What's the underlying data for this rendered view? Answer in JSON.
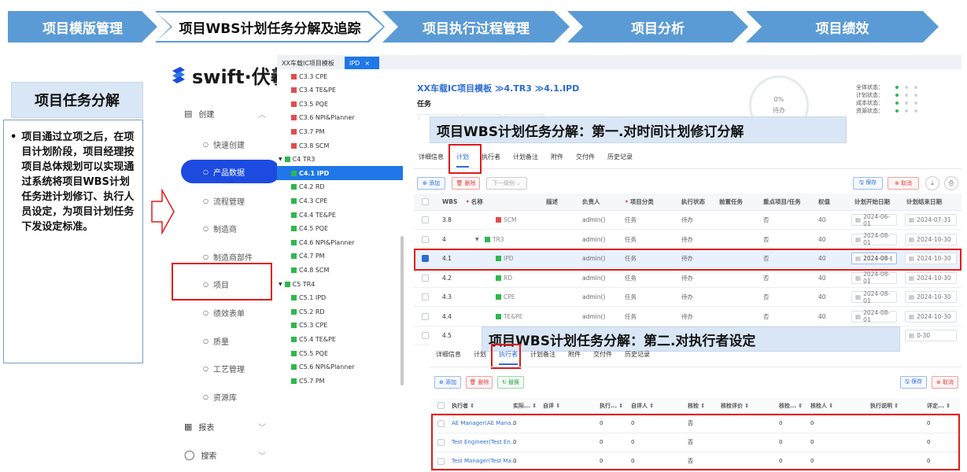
{
  "process": {
    "steps": [
      "项目模版管理",
      "项目WBS计划任务分解及追踪",
      "项目执行过程管理",
      "项目分析",
      "项目绩效"
    ],
    "active_index": 1,
    "colors": {
      "step": "#5b9bd5",
      "active": "#ffffff"
    }
  },
  "left_panel": {
    "title": "项目任务分解",
    "bullet": "•",
    "description": "项目通过立项之后，在项目计划阶段，项目经理按项目总体规划可以实现通过系统将项目WBS计划任务进计划修订、执行人员设定，为项目计划任务下发设定标准。"
  },
  "nav": {
    "logo_text": "swift·伏羲",
    "logo_icon": "swift-logo-icon",
    "create_group": "创建",
    "items": [
      "快速创建",
      "产品数据",
      "流程管理",
      "制造商",
      "制造商部件",
      "项目",
      "绩效表单",
      "质量",
      "工艺管理",
      "资源库"
    ],
    "active_item": "产品数据",
    "report_group": "报表",
    "search_group": "搜索"
  },
  "tabs": {
    "tab1": "XX车载IC项目模板",
    "tab2": "IPD",
    "close": "×"
  },
  "tree": {
    "nodes": [
      {
        "label": "C3.3 CPE",
        "color": "red",
        "level": 2
      },
      {
        "label": "C3.4 TE&PE",
        "color": "red",
        "level": 2
      },
      {
        "label": "C3.5 PQE",
        "color": "red",
        "level": 2
      },
      {
        "label": "C3.6 NPI&Planner",
        "color": "red",
        "level": 2
      },
      {
        "label": "C3.7 PM",
        "color": "red",
        "level": 2
      },
      {
        "label": "C3.8 SCM",
        "color": "red",
        "level": 2
      },
      {
        "label": "C4 TR3",
        "color": "green",
        "level": 1
      },
      {
        "label": "C4.1 IPD",
        "color": "green",
        "level": 2,
        "selected": true
      },
      {
        "label": "C4.2 RD",
        "color": "green",
        "level": 2
      },
      {
        "label": "C4.3 CPE",
        "color": "green",
        "level": 2
      },
      {
        "label": "C4.4 TE&PE",
        "color": "green",
        "level": 2
      },
      {
        "label": "C4.5 PQE",
        "color": "green",
        "level": 2
      },
      {
        "label": "C4.6 NPI&Planner",
        "color": "green",
        "level": 2
      },
      {
        "label": "C4.7 PM",
        "color": "green",
        "level": 2
      },
      {
        "label": "C4.8 SCM",
        "color": "green",
        "level": 2
      },
      {
        "label": "C5 TR4",
        "color": "green",
        "level": 1
      },
      {
        "label": "C5.1 IPD",
        "color": "green",
        "level": 2
      },
      {
        "label": "C5.2 RD",
        "color": "green",
        "level": 2
      },
      {
        "label": "C5.3 CPE",
        "color": "green",
        "level": 2
      },
      {
        "label": "C5.4 TE&PE",
        "color": "green",
        "level": 2
      },
      {
        "label": "C5.5 PQE",
        "color": "green",
        "level": 2
      },
      {
        "label": "C5.6 NPI&Planner",
        "color": "green",
        "level": 2
      },
      {
        "label": "C5.7 PM",
        "color": "green",
        "level": 2
      }
    ]
  },
  "main": {
    "breadcrumb": "XX车载IC项目模板 ≫4.TR3 ≫4.1.IPD",
    "subtitle": "任务",
    "progress": "0%",
    "progress_state": "待办",
    "status_labels": [
      "全体状态：",
      "计划状态：",
      "成本状态：",
      "资源状态："
    ],
    "banner1": "项目WBS计划任务分解：第一.对时间计划修订分解",
    "banner2": "项目WBS计划任务分解：第二.对执行者设定",
    "detail_tabs": [
      "详细信息",
      "计划",
      "执行者",
      "计划备注",
      "附件",
      "交付件",
      "历史记录"
    ],
    "toolbar": {
      "add": "⊕ 添加",
      "delete": "🗑 删除",
      "level": "下一级别 ⌄",
      "save": "🖫 保存",
      "cancel": "⊗ 取消"
    },
    "headers": [
      "WBS",
      "名称",
      "描述",
      "负责人",
      "项目分类",
      "执行状态",
      "前置任务",
      "重点项目/任务",
      "权值",
      "计划开始日期",
      "计划结束日期"
    ],
    "rows": [
      {
        "wbs": "3.8",
        "name": "SCM",
        "color": "red",
        "owner": "admin()",
        "type": "任务",
        "state": "待办",
        "key": "否",
        "weight": "40",
        "start": "2024-06-01",
        "end": "2024-07-31",
        "checked": false
      },
      {
        "wbs": "4",
        "name": "TR3",
        "color": "green",
        "owner": "admin()",
        "type": "任务",
        "state": "待办",
        "key": "否",
        "weight": "40",
        "start": "2024-08-01",
        "end": "2024-10-30",
        "checked": false
      },
      {
        "wbs": "4.1",
        "name": "IPD",
        "color": "green",
        "owner": "admin()",
        "type": "任务",
        "state": "待办",
        "key": "否",
        "weight": "40",
        "start": "2024-08-(",
        "end": "2024-10-30",
        "checked": true
      },
      {
        "wbs": "4.2",
        "name": "RD",
        "color": "green",
        "owner": "admin()",
        "type": "任务",
        "state": "待办",
        "key": "否",
        "weight": "40",
        "start": "2024-08-01",
        "end": "2024-10-30",
        "checked": false
      },
      {
        "wbs": "4.3",
        "name": "CPE",
        "color": "green",
        "owner": "admin()",
        "type": "任务",
        "state": "待办",
        "key": "否",
        "weight": "40",
        "start": "2024-08-01",
        "end": "2024-10-30",
        "checked": false
      },
      {
        "wbs": "4.4",
        "name": "TE&PE",
        "color": "green",
        "owner": "admin()",
        "type": "任务",
        "state": "待办",
        "key": "否",
        "weight": "40",
        "start": "2024-08-01",
        "end": "2024-10-30",
        "checked": false
      },
      {
        "wbs": "4.5",
        "name": "",
        "color": "green",
        "owner": "",
        "type": "",
        "state": "",
        "key": "",
        "weight": "",
        "start": "",
        "end": "0-30",
        "checked": false
      }
    ]
  },
  "exec": {
    "tabs": [
      "详细信息",
      "计划",
      "执行者",
      "计划备注",
      "附件",
      "交付件",
      "历史记录"
    ],
    "toolbar": {
      "add": "⊕ 添加",
      "delete": "🗑 删除",
      "replace": "↻ 替换",
      "save": "🖫 保存",
      "cancel": "⊗ 取消"
    },
    "headers": [
      "执行者 ⇕",
      "实际... ⇕",
      "自评 ⇕",
      "执行... ⇕",
      "自评人 ⇕",
      "核检 ⇕",
      "核检评价 ⇕",
      "核检... ⇕",
      "核检人 ⇕",
      "执行说明 ⇕",
      "评定... ⇕"
    ],
    "rows": [
      {
        "name": "AE Manager(AE Mana...",
        "a": "0",
        "b": "0",
        "c": "0",
        "chk": "否",
        "d": "0",
        "e": "0",
        "f": "0"
      },
      {
        "name": "Test Engineer(Test En...",
        "a": "0",
        "b": "0",
        "c": "0",
        "chk": "否",
        "d": "0",
        "e": "0",
        "f": "0"
      },
      {
        "name": "Test Manager(Test Ma...",
        "a": "0",
        "b": "0",
        "c": "0",
        "chk": "否",
        "d": "0",
        "e": "0",
        "f": "0"
      }
    ]
  }
}
